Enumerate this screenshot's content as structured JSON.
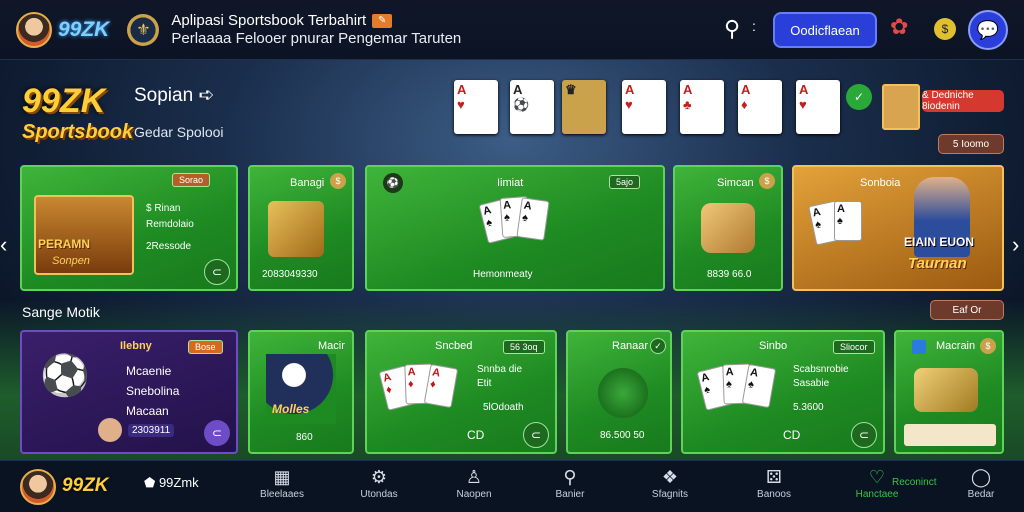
{
  "header": {
    "brand": "99ZK",
    "app_title": "Aplipasi Sportsbook Terbahirt",
    "app_subtitle": "Perlaaaa Felooer pnurar Pengemar Taruten",
    "primary_button": "Oodicflaean",
    "search_icon": "search-icon",
    "more_icon": "more-icon"
  },
  "hero": {
    "logo_line1": "99ZK",
    "logo_line2": "Sportsbook",
    "heading": "Sopian",
    "subheading": "Gedar Spolooi",
    "promo_button": "& Dedniche 8iodenin",
    "small_button": "5 Ioomo"
  },
  "tiles_row1": [
    {
      "tag": "Sorao",
      "lines": [
        "$ Rinan",
        "Remdolaio",
        "2Ressode"
      ],
      "banner": "PERAMN",
      "banner2": "Sonpen"
    },
    {
      "title": "Banagi",
      "footer": "2083049330"
    },
    {
      "title": "Iimiat",
      "tag": "5ajo",
      "footer": "Hemonmeaty"
    },
    {
      "title": "Simcan",
      "footer": "8839 66.0"
    },
    {
      "title": "Sonboia",
      "banner": "EIAIN EUON",
      "banner2": "Taurnan"
    }
  ],
  "section": {
    "title": "Sange Motik",
    "button": "Eaf Or"
  },
  "tiles_row2": [
    {
      "title": "Ilebny",
      "tag": "Bose",
      "lines": [
        "Mcaenie",
        "Snebolina",
        "Macaan"
      ],
      "footer": "2303911"
    },
    {
      "title": "Macir",
      "banner": "Molles",
      "footer": "860"
    },
    {
      "title": "Sncbed",
      "tag": "56 3oq",
      "lines": [
        "Snnba die",
        "Etit"
      ],
      "footer": "5lOdoath",
      "foot2": "CD"
    },
    {
      "title": "Ranaar",
      "footer": "86.500 50"
    },
    {
      "title": "Sinbo",
      "tag": "Sliocor",
      "lines": [
        "Scabsnrobie",
        "Sasabie"
      ],
      "footer": "5.3600",
      "foot2": "CD"
    },
    {
      "title": "Macrain",
      "footer": ""
    }
  ],
  "bottom_nav": {
    "brand": "99ZK",
    "badge": "99Zmk",
    "items": [
      {
        "label": "Bleelaaes",
        "icon": "calendar-icon"
      },
      {
        "label": "Utondas",
        "icon": "gear-icon"
      },
      {
        "label": "Naopen",
        "icon": "user-icon"
      },
      {
        "label": "Banier",
        "icon": "search-icon"
      },
      {
        "label": "Sfagnits",
        "icon": "cards-icon"
      },
      {
        "label": "Banoos",
        "icon": "dice-icon"
      },
      {
        "label": "Hanctaee",
        "icon": "heart-icon"
      },
      {
        "label": "Bedar",
        "icon": "chat-icon"
      }
    ],
    "highlight_label": "Reconinct",
    "accent": "#38c44a"
  },
  "colors": {
    "brand_blue": "#2a3fd9",
    "tile_green": "#2a9e2c",
    "gold": "#ffcf3a"
  }
}
